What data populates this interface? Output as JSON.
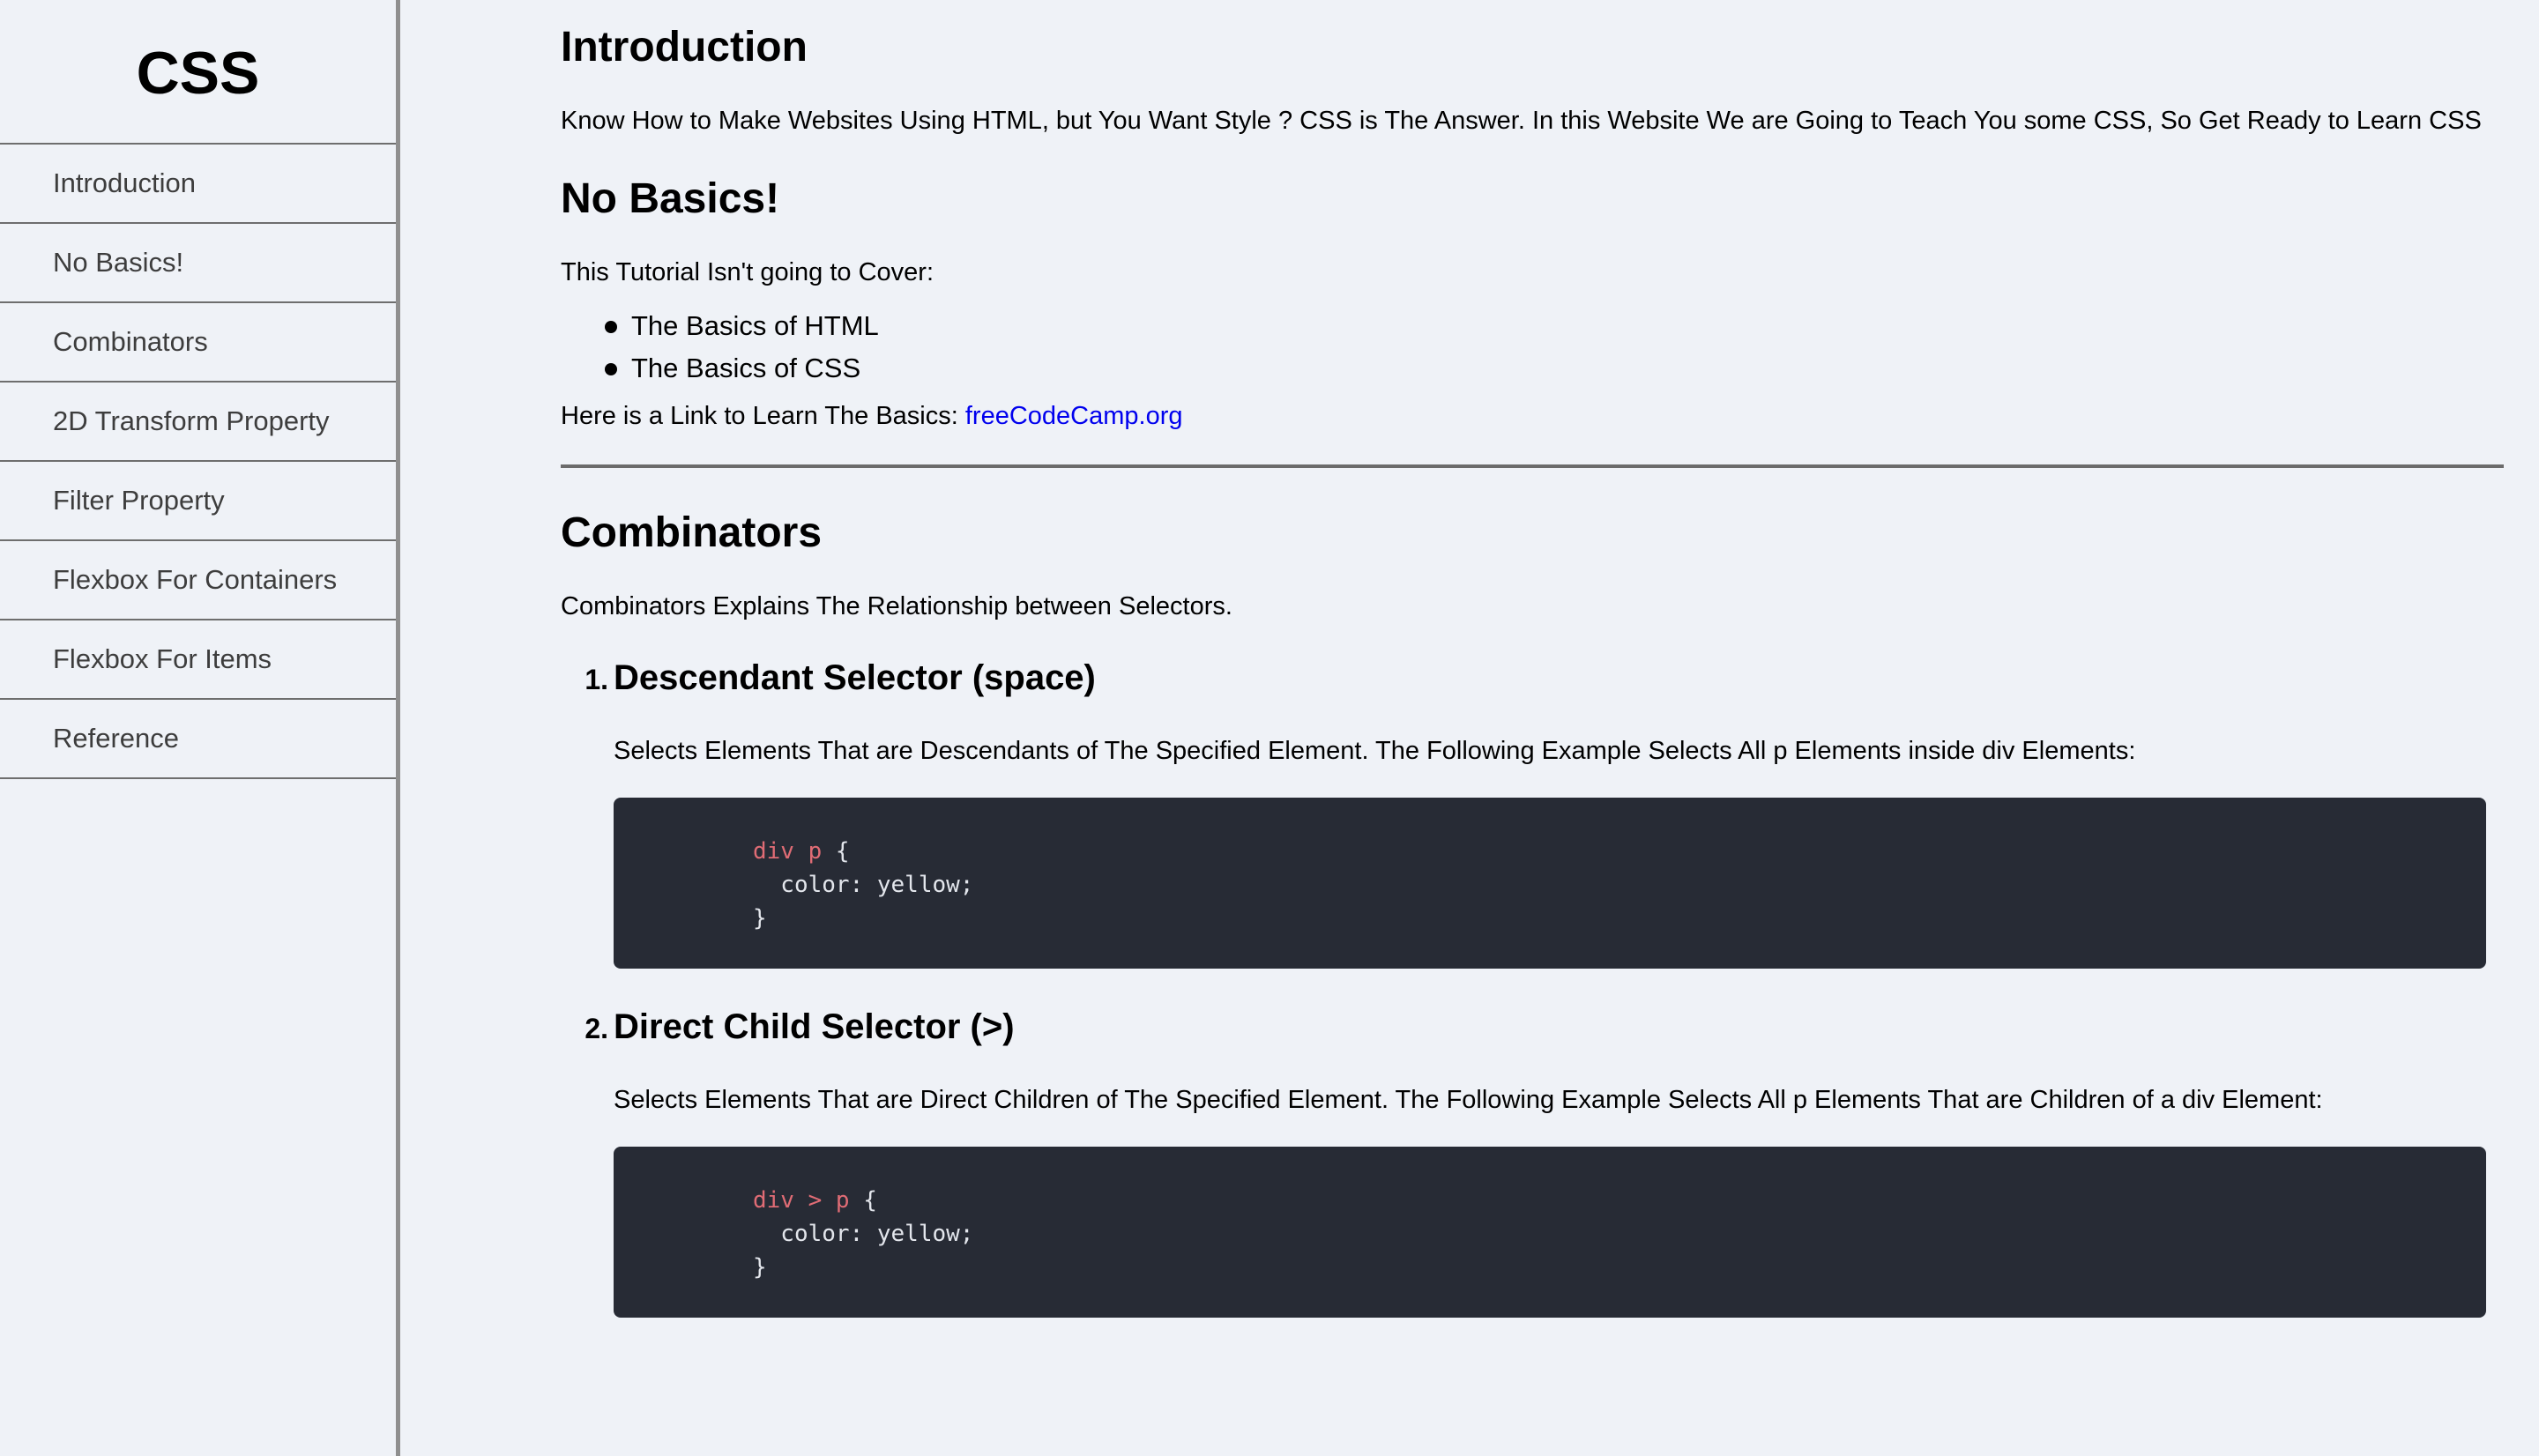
{
  "sidebar": {
    "title": "CSS",
    "items": [
      {
        "label": "Introduction"
      },
      {
        "label": "No Basics!"
      },
      {
        "label": "Combinators"
      },
      {
        "label": "2D Transform Property"
      },
      {
        "label": "Filter Property"
      },
      {
        "label": "Flexbox For Containers"
      },
      {
        "label": "Flexbox For Items"
      },
      {
        "label": "Reference"
      }
    ]
  },
  "main": {
    "introduction": {
      "title": "Introduction",
      "text": "Know How to Make Websites Using HTML, but You Want Style ? CSS is The Answer. In this Website We are Going to Teach You some CSS, So Get Ready to Learn CSS"
    },
    "no_basics": {
      "title": "No Basics!",
      "intro": "This Tutorial Isn't going to Cover:",
      "bullets": [
        "The Basics of HTML",
        "The Basics of CSS"
      ],
      "link_prefix": "Here is a Link to Learn The Basics: ",
      "link_text": "freeCodeCamp.org"
    },
    "combinators": {
      "title": "Combinators",
      "intro": "Combinators Explains The Relationship between Selectors.",
      "items": [
        {
          "number": "1.",
          "heading": "Descendant Selector (space)",
          "description": "Selects Elements That are Descendants of The Specified Element. The Following Example Selects All p Elements inside div Elements:",
          "code_selector": "div p",
          "code_open": " {",
          "code_body": "  color: yellow;",
          "code_close": "}"
        },
        {
          "number": "2.",
          "heading": "Direct Child Selector (>)",
          "description": "Selects Elements That are Direct Children of The Specified Element. The Following Example Selects All p Elements That are Children of a div Element:",
          "code_selector": "div > p",
          "code_open": " {",
          "code_body": "  color: yellow;",
          "code_close": "}"
        }
      ]
    }
  },
  "colors": {
    "background": "#eff2f7",
    "link": "#0000ee",
    "code_background": "#272b35",
    "code_selector": "#e06c75"
  }
}
